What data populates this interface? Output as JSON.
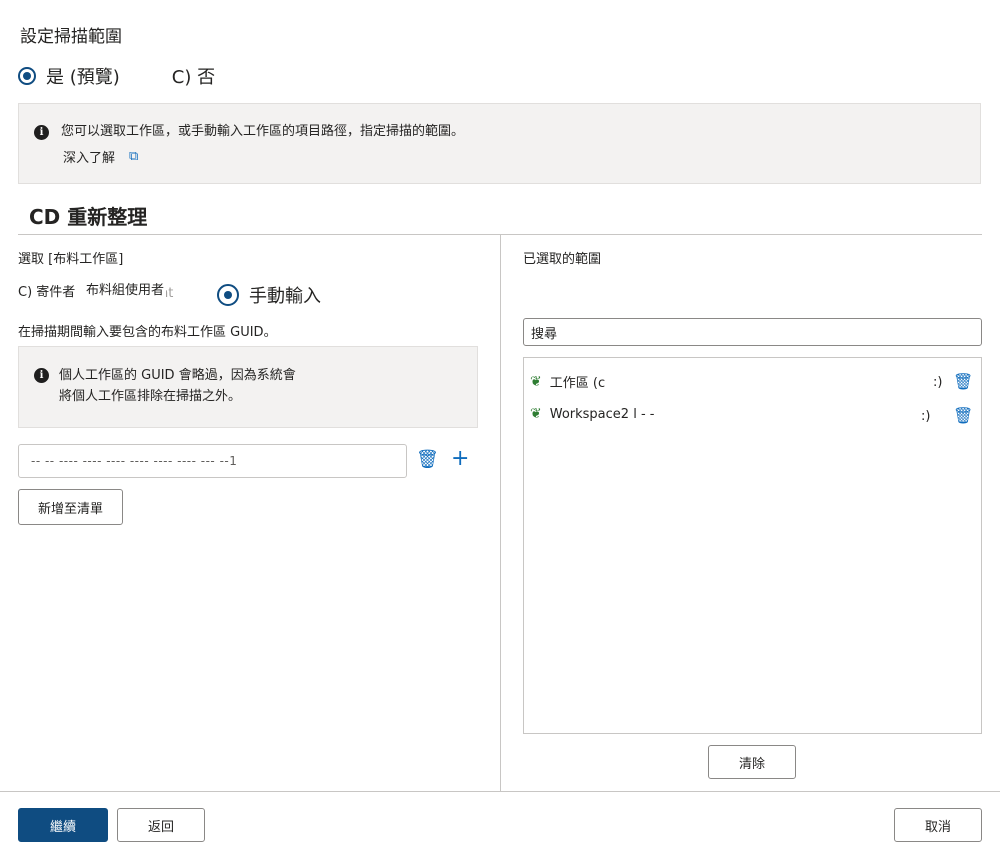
{
  "header": {
    "scope_title": "設定掃描範圍"
  },
  "scope_choice": {
    "yes_label": "是 (預覽)",
    "no_label": "C) 否",
    "selected": "yes"
  },
  "info_banner": {
    "text": "您可以選取工作區，或手動輸入工作區的項目路徑，指定掃描的範圍。",
    "link_label": "深入了解"
  },
  "section": {
    "title": "CD 重新整理"
  },
  "left_panel": {
    "select_label": "選取 [布料工作區]",
    "source_option_1": "C) 寄件者",
    "source_option_1_value": "布料組使用者",
    "source_option_1_ghost": "Fabric tenant",
    "source_option_2": "手動輸入",
    "instruction": "在掃描期間輸入要包含的布料工作區 GUID。",
    "note_line_1": "個人工作區的 GUID 會略過，因為系統會",
    "note_line_2": "將個人工作區排除在掃描之外。",
    "guid_value": "-- -- ---- ---- ---- ---- ---- ---- --- --1",
    "add_button": "新增至清單"
  },
  "right_panel": {
    "selected_label": "已選取的範圍",
    "search_placeholder": "搜尋",
    "items": [
      {
        "label": "工作區 (c",
        "suffix": ":)"
      },
      {
        "label": "Workspace2 l - -",
        "suffix": ":)"
      }
    ],
    "clear_button": "清除"
  },
  "footer": {
    "continue_button": "繼續",
    "back_button": "返回",
    "cancel_button": "取消"
  },
  "colors": {
    "primary": "#0f4c81",
    "link": "#0f6cbd",
    "panel_bg": "#f3f2f1",
    "workspace_icon": "#2e7d32"
  },
  "icons": {
    "info": "info-icon",
    "external": "external-link-icon",
    "trash": "trash-icon",
    "add": "plus-icon",
    "workspace": "workspace-icon"
  }
}
